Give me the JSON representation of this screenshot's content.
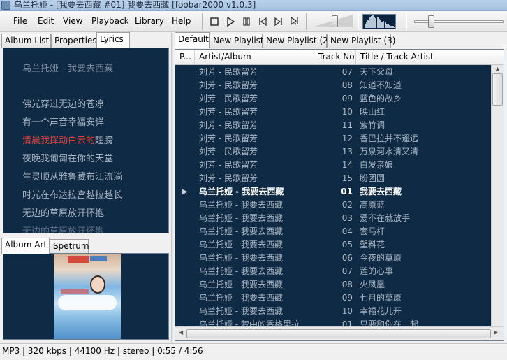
{
  "window": {
    "title": "乌兰托娅 - [我要去西藏 #01] 我要去西藏   [foobar2000 v1.0.3]"
  },
  "menu": [
    "File",
    "Edit",
    "View",
    "Playback",
    "Library",
    "Help"
  ],
  "toolbar": {
    "icons": [
      "stop-icon",
      "play-icon",
      "pause-icon",
      "previous-icon",
      "next-icon",
      "random-icon"
    ],
    "volume_fraction": 0.55,
    "seek_fraction": 0.17
  },
  "left_tabs": [
    "Album List",
    "Properties",
    "Lyrics"
  ],
  "left_active_tab": "Lyrics",
  "lyrics": {
    "title_line": "乌兰托娅 - 我要去西藏",
    "lines": [
      "佛光穿过无边的苍凉",
      "有一个声音幸福安详",
      "清晨我挥动白云的翅膀",
      "夜晚我匍匐在你的天堂",
      "生灵顺从雅鲁藏布江流淌",
      "时光在布达拉宫越拉越长",
      "无边的草原放开怀抱",
      "无边的草原放开怀抱"
    ],
    "highlight": {
      "line_index": 2,
      "sung_text": "清晨我挥动白云的",
      "rest_text": "翅膀"
    }
  },
  "art_tabs": [
    "Album Art",
    "Spetrum"
  ],
  "art_active_tab": "Album Art",
  "playlist_tabs": [
    "Default",
    "New Playlist",
    "New Playlist (2)",
    "New Playlist (3)"
  ],
  "playlist_active_tab": "Default",
  "columns": [
    "P...",
    "Artist/Album",
    "Track No",
    "Title / Track Artist"
  ],
  "rows": [
    {
      "artist": "刘芳 - 民歌留芳",
      "no": "07",
      "title": "天下父母",
      "playing": false
    },
    {
      "artist": "刘芳 - 民歌留芳",
      "no": "08",
      "title": "知道不知道",
      "playing": false
    },
    {
      "artist": "刘芳 - 民歌留芳",
      "no": "09",
      "title": "蓝色的故乡",
      "playing": false
    },
    {
      "artist": "刘芳 - 民歌留芳",
      "no": "10",
      "title": "映山红",
      "playing": false
    },
    {
      "artist": "刘芳 - 民歌留芳",
      "no": "11",
      "title": "紫竹调",
      "playing": false
    },
    {
      "artist": "刘芳 - 民歌留芳",
      "no": "12",
      "title": "香巴拉并不遥远",
      "playing": false
    },
    {
      "artist": "刘芳 - 民歌留芳",
      "no": "13",
      "title": "万泉河水清又清",
      "playing": false
    },
    {
      "artist": "刘芳 - 民歌留芳",
      "no": "14",
      "title": "白发亲娘",
      "playing": false
    },
    {
      "artist": "刘芳 - 民歌留芳",
      "no": "15",
      "title": "盼团圆",
      "playing": false
    },
    {
      "artist": "乌兰托娅 - 我要去西藏",
      "no": "01",
      "title": "我要去西藏",
      "playing": true,
      "indicator": "▶"
    },
    {
      "artist": "乌兰托娅 - 我要去西藏",
      "no": "02",
      "title": "高原蓝",
      "playing": false
    },
    {
      "artist": "乌兰托娅 - 我要去西藏",
      "no": "03",
      "title": "爱不在就放手",
      "playing": false
    },
    {
      "artist": "乌兰托娅 - 我要去西藏",
      "no": "04",
      "title": "套马杆",
      "playing": false
    },
    {
      "artist": "乌兰托娅 - 我要去西藏",
      "no": "05",
      "title": "塑料花",
      "playing": false
    },
    {
      "artist": "乌兰托娅 - 我要去西藏",
      "no": "06",
      "title": "今夜的草原",
      "playing": false
    },
    {
      "artist": "乌兰托娅 - 我要去西藏",
      "no": "07",
      "title": "莲的心事",
      "playing": false
    },
    {
      "artist": "乌兰托娅 - 我要去西藏",
      "no": "08",
      "title": "火凤凰",
      "playing": false
    },
    {
      "artist": "乌兰托娅 - 我要去西藏",
      "no": "09",
      "title": "七月的草原",
      "playing": false
    },
    {
      "artist": "乌兰托娅 - 我要去西藏",
      "no": "10",
      "title": "幸福花儿开",
      "playing": false
    },
    {
      "artist": "乌兰托娅 - 梦中的香格里拉",
      "no": "01",
      "title": "只要和你在一起",
      "playing": false
    }
  ],
  "status": "MP3 | 320 kbps | 44100 Hz | stereo | 0:55 / 4:56"
}
